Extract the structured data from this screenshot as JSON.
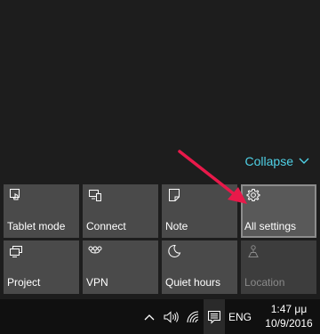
{
  "action_center": {
    "collapse_label": "Collapse",
    "accent_color": "#4fd1e6",
    "tiles": [
      {
        "label": "Tablet mode",
        "icon": "tablet-mode-icon",
        "state": "normal"
      },
      {
        "label": "Connect",
        "icon": "connect-icon",
        "state": "normal"
      },
      {
        "label": "Note",
        "icon": "note-icon",
        "state": "normal"
      },
      {
        "label": "All settings",
        "icon": "gear-icon",
        "state": "selected"
      },
      {
        "label": "Project",
        "icon": "project-icon",
        "state": "normal"
      },
      {
        "label": "VPN",
        "icon": "vpn-icon",
        "state": "normal"
      },
      {
        "label": "Quiet hours",
        "icon": "moon-icon",
        "state": "normal"
      },
      {
        "label": "Location",
        "icon": "location-icon",
        "state": "disabled"
      }
    ]
  },
  "annotation": {
    "color": "#e8194a",
    "points_to": "All settings"
  },
  "taskbar": {
    "tray_icons": [
      "chevron-up-icon",
      "volume-icon",
      "wifi-icon",
      "action-center-icon"
    ],
    "language": "ENG",
    "time": "1:47 μμ",
    "date": "10/9/2016"
  }
}
